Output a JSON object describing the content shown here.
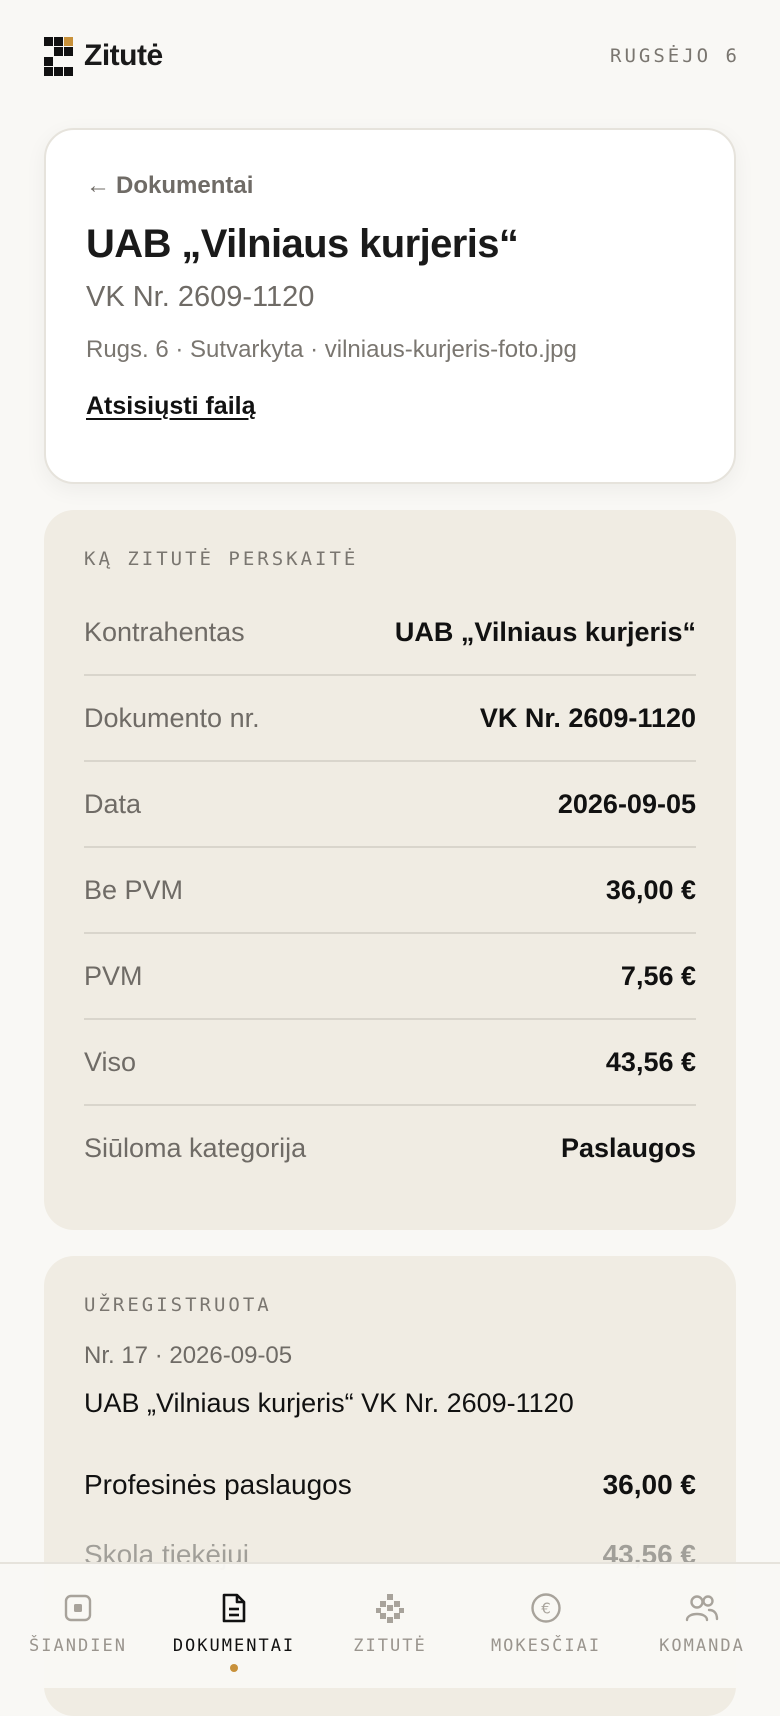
{
  "header": {
    "brand": "Zitutė",
    "date": "RUGSĖJO 6"
  },
  "document": {
    "back_label": "Dokumentai",
    "title": "UAB „Vilniaus kurjeris“",
    "number": "VK Nr. 2609-1120",
    "meta": "Rugs. 6 · Sutvarkyta · vilniaus-kurjeris-foto.jpg",
    "download_label": "Atsisiųsti failą"
  },
  "read_section": {
    "label": "KĄ ZITUTĖ PERSKAITĖ",
    "rows": [
      {
        "label": "Kontrahentas",
        "value": "UAB „Vilniaus kurjeris“"
      },
      {
        "label": "Dokumento nr.",
        "value": "VK Nr. 2609-1120"
      },
      {
        "label": "Data",
        "value": "2026-09-05"
      },
      {
        "label": "Be PVM",
        "value": "36,00 €"
      },
      {
        "label": "PVM",
        "value": "7,56 €"
      },
      {
        "label": "Viso",
        "value": "43,56 €"
      },
      {
        "label": "Siūloma kategorija",
        "value": "Paslaugos"
      }
    ]
  },
  "registered_section": {
    "label": "UŽREGISTRUOTA",
    "meta": "Nr. 17 · 2026-09-05",
    "title": "UAB „Vilniaus kurjeris“ VK Nr. 2609-1120",
    "lines": [
      {
        "label": "Profesinės paslaugos",
        "value": "36,00 €"
      },
      {
        "label": "Skola tiekėjui",
        "value": "43,56 €"
      }
    ]
  },
  "nav": {
    "items": [
      {
        "label": "ŠIANDIEN",
        "icon": "today-icon"
      },
      {
        "label": "DOKUMENTAI",
        "icon": "document-icon"
      },
      {
        "label": "ZITUTĖ",
        "icon": "zitute-icon"
      },
      {
        "label": "MOKESČIAI",
        "icon": "euro-icon"
      },
      {
        "label": "KOMANDA",
        "icon": "team-icon"
      }
    ],
    "active_index": 1
  },
  "colors": {
    "accent": "#c8913a",
    "panel": "#f0ece3",
    "background": "#f9f8f5"
  }
}
